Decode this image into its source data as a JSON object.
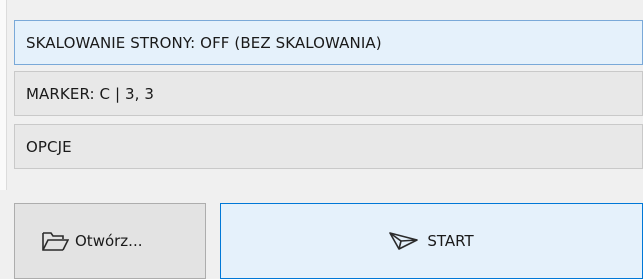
{
  "options_list": {
    "rows": [
      {
        "label": "SKALOWANIE STRONY: OFF (BEZ SKALOWANIA)",
        "selected": true
      },
      {
        "label": "MARKER: C | 3, 3",
        "selected": false
      },
      {
        "label": "OPCJE",
        "selected": false
      }
    ]
  },
  "buttons": {
    "open_label": "Otwórz...",
    "open_icon": "folder-open-icon",
    "start_label": "START",
    "start_icon": "paper-plane-icon"
  },
  "colors": {
    "selected_row_bg": "#e5f1fb",
    "selected_row_border": "#7aa9d8",
    "start_button_border": "#0078d7"
  }
}
